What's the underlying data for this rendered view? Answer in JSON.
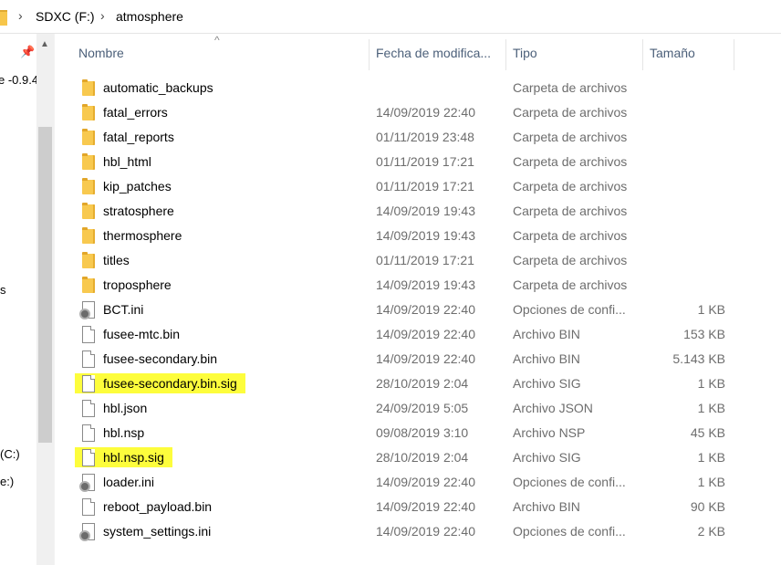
{
  "address": {
    "crumbs": [
      "SDXC (F:)",
      "atmosphere"
    ]
  },
  "nav": {
    "fragments": [
      "e -0.9.4",
      "s",
      "(C:)",
      "e:)"
    ]
  },
  "columns": {
    "name": "Nombre",
    "date": "Fecha de modifica...",
    "type": "Tipo",
    "size": "Tamaño"
  },
  "files": [
    {
      "name": "automatic_backups",
      "date": "",
      "type": "Carpeta de archivos",
      "size": "",
      "icon": "folder-icon"
    },
    {
      "name": "fatal_errors",
      "date": "14/09/2019 22:40",
      "type": "Carpeta de archivos",
      "size": "",
      "icon": "folder-icon"
    },
    {
      "name": "fatal_reports",
      "date": "01/11/2019 23:48",
      "type": "Carpeta de archivos",
      "size": "",
      "icon": "folder-icon"
    },
    {
      "name": "hbl_html",
      "date": "01/11/2019 17:21",
      "type": "Carpeta de archivos",
      "size": "",
      "icon": "folder-icon"
    },
    {
      "name": "kip_patches",
      "date": "01/11/2019 17:21",
      "type": "Carpeta de archivos",
      "size": "",
      "icon": "folder-icon"
    },
    {
      "name": "stratosphere",
      "date": "14/09/2019 19:43",
      "type": "Carpeta de archivos",
      "size": "",
      "icon": "folder-icon"
    },
    {
      "name": "thermosphere",
      "date": "14/09/2019 19:43",
      "type": "Carpeta de archivos",
      "size": "",
      "icon": "folder-icon"
    },
    {
      "name": "titles",
      "date": "01/11/2019 17:21",
      "type": "Carpeta de archivos",
      "size": "",
      "icon": "folder-icon"
    },
    {
      "name": "troposphere",
      "date": "14/09/2019 19:43",
      "type": "Carpeta de archivos",
      "size": "",
      "icon": "folder-icon"
    },
    {
      "name": "BCT.ini",
      "date": "14/09/2019 22:40",
      "type": "Opciones de confi...",
      "size": "1 KB",
      "icon": "settings-file-icon"
    },
    {
      "name": "fusee-mtc.bin",
      "date": "14/09/2019 22:40",
      "type": "Archivo BIN",
      "size": "153 KB",
      "icon": "file-icon"
    },
    {
      "name": "fusee-secondary.bin",
      "date": "14/09/2019 22:40",
      "type": "Archivo BIN",
      "size": "5.143 KB",
      "icon": "file-icon"
    },
    {
      "name": "fusee-secondary.bin.sig",
      "date": "28/10/2019 2:04",
      "type": "Archivo SIG",
      "size": "1 KB",
      "icon": "file-icon",
      "highlight": "#fdfd3c"
    },
    {
      "name": "hbl.json",
      "date": "24/09/2019 5:05",
      "type": "Archivo JSON",
      "size": "1 KB",
      "icon": "file-icon"
    },
    {
      "name": "hbl.nsp",
      "date": "09/08/2019 3:10",
      "type": "Archivo NSP",
      "size": "45 KB",
      "icon": "file-icon"
    },
    {
      "name": "hbl.nsp.sig",
      "date": "28/10/2019 2:04",
      "type": "Archivo SIG",
      "size": "1 KB",
      "icon": "file-icon",
      "highlight": "#fdfd3c"
    },
    {
      "name": "loader.ini",
      "date": "14/09/2019 22:40",
      "type": "Opciones de confi...",
      "size": "1 KB",
      "icon": "settings-file-icon"
    },
    {
      "name": "reboot_payload.bin",
      "date": "14/09/2019 22:40",
      "type": "Archivo BIN",
      "size": "90 KB",
      "icon": "file-icon"
    },
    {
      "name": "system_settings.ini",
      "date": "14/09/2019 22:40",
      "type": "Opciones de confi...",
      "size": "2 KB",
      "icon": "settings-file-icon"
    }
  ]
}
